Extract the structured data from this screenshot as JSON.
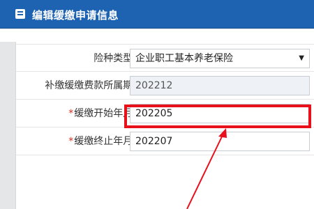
{
  "header": {
    "title": "编辑缓缴申请信息",
    "icon": "edit-list-icon"
  },
  "form": {
    "insurance_type": {
      "label": "险种类型:",
      "value": "企业职工基本养老保险",
      "required": false
    },
    "period": {
      "label": "补缴缓缴费款所属期:",
      "value": "202212",
      "required": false
    },
    "start": {
      "label": "缓缴开始年月:",
      "value": "202205",
      "required": true
    },
    "end": {
      "label": "缓缴终止年月:",
      "value": "202207",
      "required": true
    },
    "required_mark": "*"
  },
  "colors": {
    "header_bg": "#1e63b1",
    "highlight": "#e8101a",
    "required": "#e02b20"
  }
}
